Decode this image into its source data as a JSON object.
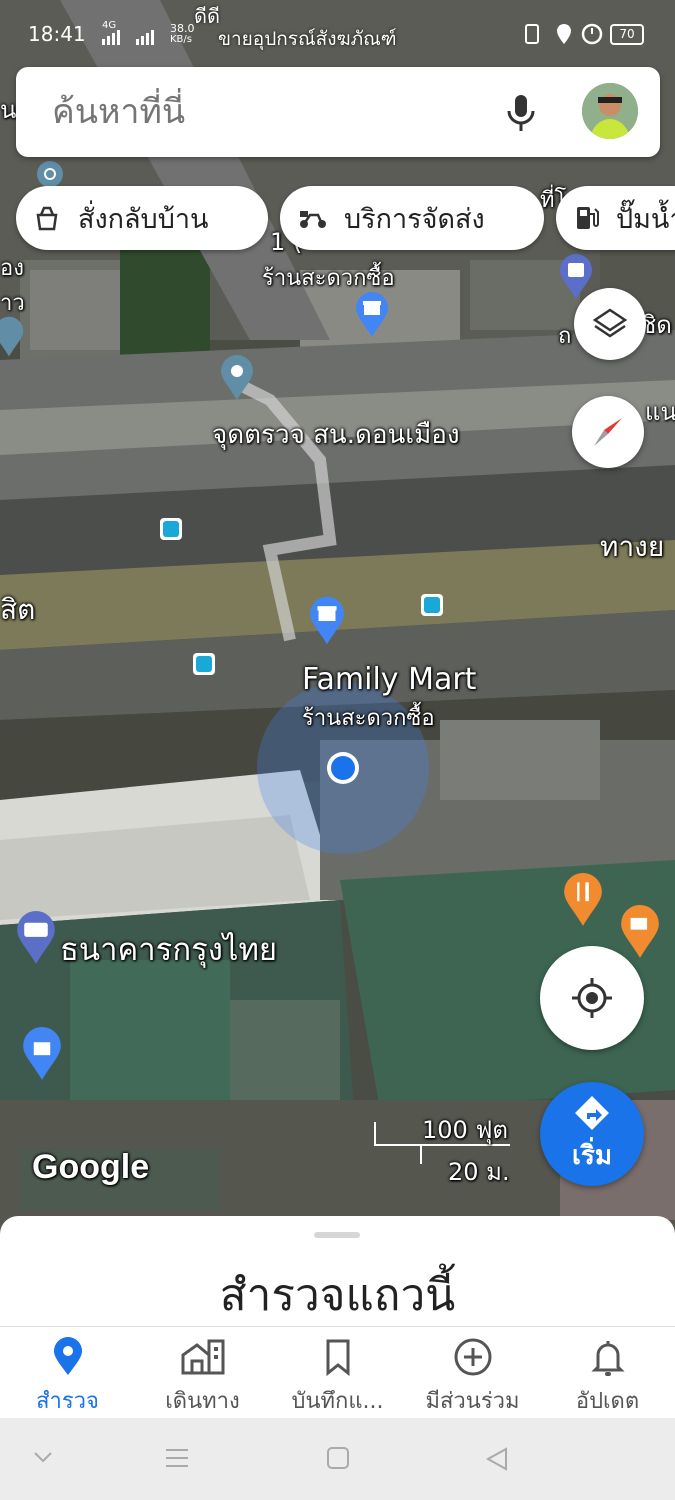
{
  "status": {
    "time": "18:41",
    "network": "4G",
    "speed_value": "38.0",
    "speed_unit": "KB/s",
    "battery": "70",
    "top_text": "ขายอุปกรณ์สังฆภัณฑ์",
    "top_text2": "ดีดี"
  },
  "search": {
    "placeholder": "ค้นหาที่นี่"
  },
  "chips": [
    {
      "label": "สั่งกลับบ้าน",
      "icon": "takeout-icon"
    },
    {
      "label": "บริการจัดส่ง",
      "icon": "delivery-scooter-icon"
    },
    {
      "label": "ปั๊มน้ำ",
      "icon": "gas-station-icon"
    }
  ],
  "map": {
    "labels": {
      "store_top_line": "1 (",
      "store_top": "ร้านสะดวกซื้อ",
      "checkpoint": "จุดตรวจ สน.ดอนเมือง",
      "family_mart": "Family Mart",
      "family_mart_sub": "ร้านสะดวกซื้อ",
      "bank": "ธนาคารกรุงไทย",
      "edge_left_1": "อง",
      "edge_left_2": "าว",
      "edge_left_3": "สิต",
      "edge_left_top": "น",
      "edge_right_1": "ชิด",
      "edge_right_2": "แน",
      "edge_right_3": "ทางย",
      "edge_right_4": "ที่โ",
      "edge_right_5": "ถ",
      "google": "Google",
      "scale_ft": "100 ฟุต",
      "scale_m": "20 ม."
    },
    "start_label": "เริ่ม"
  },
  "sheet": {
    "title": "สำรวจแถวนี้"
  },
  "bottom_nav": [
    {
      "label": "สำรวจ",
      "icon": "location-pin-icon",
      "active": true
    },
    {
      "label": "เดินทาง",
      "icon": "commute-icon",
      "active": false
    },
    {
      "label": "บันทึกแ...",
      "icon": "bookmark-icon",
      "active": false
    },
    {
      "label": "มีส่วนร่วม",
      "icon": "add-circle-icon",
      "active": false
    },
    {
      "label": "อัปเดต",
      "icon": "bell-icon",
      "active": false
    }
  ],
  "colors": {
    "accent": "#1a73e8",
    "pin_blue": "#4285f4",
    "pin_orange": "#f28b30",
    "pin_bank": "#5b6fc9",
    "bus": "#18a9d8"
  }
}
